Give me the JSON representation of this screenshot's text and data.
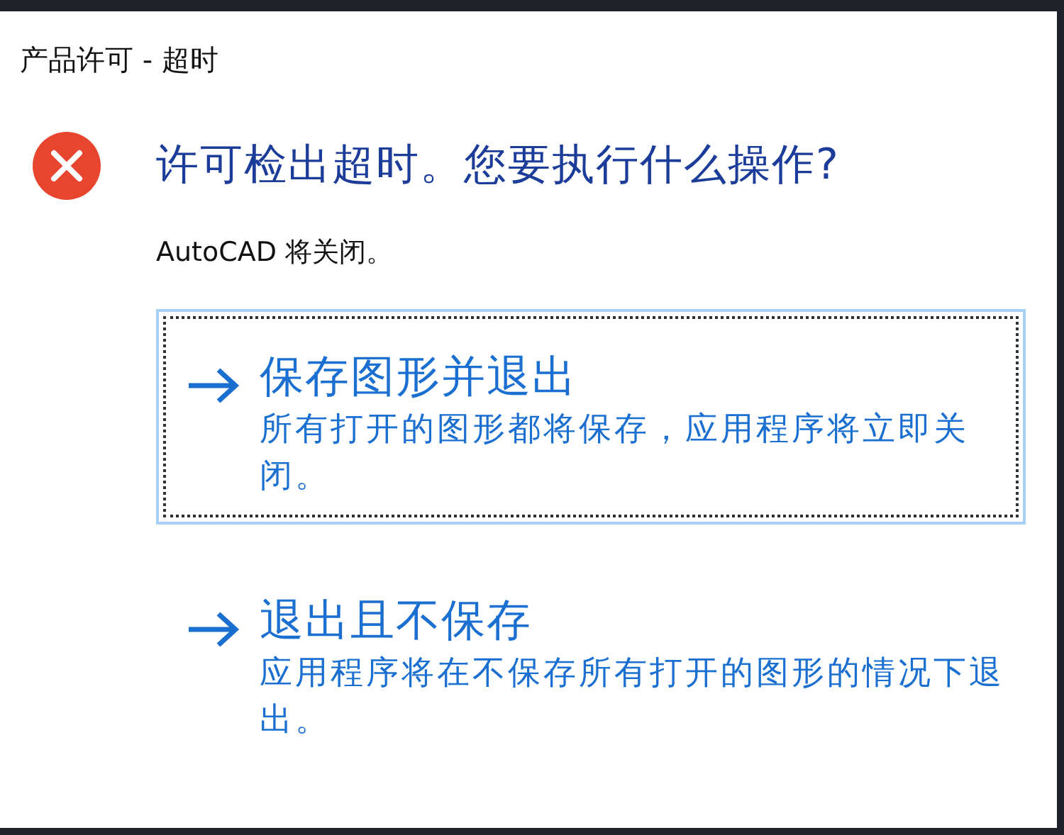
{
  "window": {
    "title": "产品许可 - 超时"
  },
  "heading": "许可检出超时。您要执行什么操作?",
  "message": "AutoCAD 将关闭。",
  "options": [
    {
      "title": "保存图形并退出",
      "description": "所有打开的图形都将保存，应用程序将立即关闭。",
      "selected": true
    },
    {
      "title": "退出且不保存",
      "description": "应用程序将在不保存所有打开的图形的情况下退出。",
      "selected": false
    }
  ]
}
